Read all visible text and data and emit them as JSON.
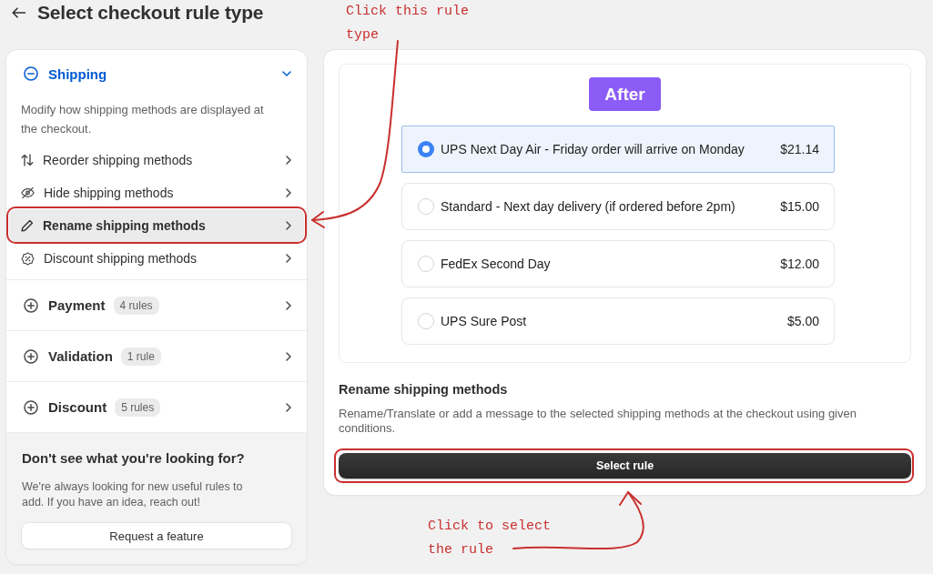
{
  "header": {
    "title": "Select checkout rule type"
  },
  "categories": [
    {
      "name": "Shipping",
      "expanded": true,
      "description": "Modify how shipping methods are displayed at the checkout.",
      "rules": [
        {
          "label": "Reorder shipping methods",
          "selected": false
        },
        {
          "label": "Hide shipping methods",
          "selected": false
        },
        {
          "label": "Rename shipping methods",
          "selected": true
        },
        {
          "label": "Discount shipping methods",
          "selected": false
        }
      ]
    },
    {
      "name": "Payment",
      "expanded": false,
      "count": "4 rules"
    },
    {
      "name": "Validation",
      "expanded": false,
      "count": "1 rule"
    },
    {
      "name": "Discount",
      "expanded": false,
      "count": "5 rules"
    }
  ],
  "help": {
    "title": "Don't see what you're looking for?",
    "text": "We're always looking for new useful rules to add. If you have an idea, reach out!",
    "button": "Request a feature"
  },
  "preview": {
    "tag": "After",
    "options": [
      {
        "label": "UPS Next Day Air - Friday order will arrive on Monday",
        "price": "$21.14",
        "selected": true
      },
      {
        "label": "Standard - Next day delivery (if ordered before 2pm)",
        "price": "$15.00",
        "selected": false
      },
      {
        "label": "FedEx Second Day",
        "price": "$12.00",
        "selected": false
      },
      {
        "label": "UPS Sure Post",
        "price": "$5.00",
        "selected": false
      }
    ]
  },
  "detail": {
    "title": "Rename shipping methods",
    "description": "Rename/Translate or add a message to the selected shipping methods at the checkout using given conditions.",
    "button": "Select rule"
  },
  "annotations": [
    {
      "text": "Click this rule type"
    },
    {
      "text": "Click to select the rule"
    }
  ]
}
